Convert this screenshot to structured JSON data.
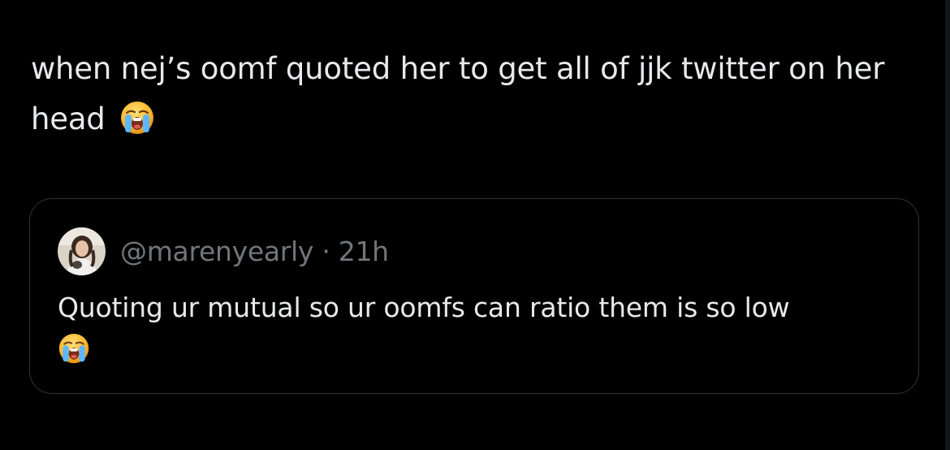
{
  "tweet": {
    "text": "when nej’s oomf quoted her to get all of jjk twitter on her head",
    "emoji": "loudly-crying-face-emoji"
  },
  "quote": {
    "handle": "@marenyearly",
    "separator": "·",
    "time": "21h",
    "text": "Quoting ur mutual so ur oomfs can ratio them is so low",
    "emoji": "loudly-crying-face-emoji"
  },
  "colors": {
    "background": "#000000",
    "text_primary": "#e7e9ea",
    "text_secondary": "#71767b",
    "card_border": "#2f3336"
  }
}
